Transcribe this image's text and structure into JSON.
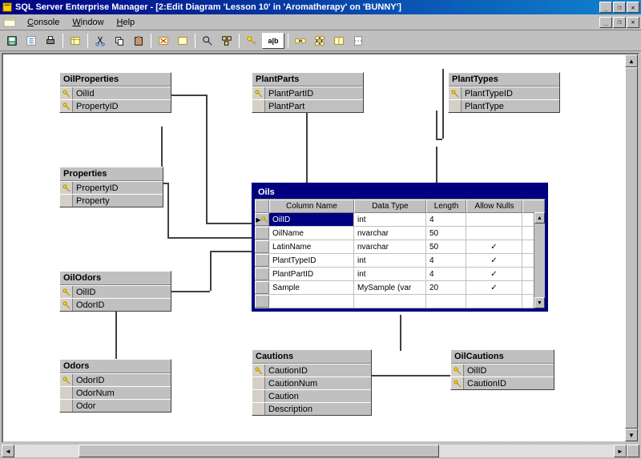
{
  "window": {
    "title": "SQL Server Enterprise Manager - [2:Edit Diagram 'Lesson 10' in 'Aromatherapy' on 'BUNNY']"
  },
  "menu": {
    "console": "Console",
    "window": "Window",
    "help": "Help"
  },
  "toolbar": {
    "ab_label": "a|b"
  },
  "tables": {
    "oilproperties": {
      "title": "OilProperties",
      "cols": [
        {
          "key": true,
          "name": "OilId"
        },
        {
          "key": true,
          "name": "PropertyID"
        }
      ]
    },
    "plantparts": {
      "title": "PlantParts",
      "cols": [
        {
          "key": true,
          "name": "PlantPartID"
        },
        {
          "key": false,
          "name": "PlantPart"
        }
      ]
    },
    "planttypes": {
      "title": "PlantTypes",
      "cols": [
        {
          "key": true,
          "name": "PlantTypeID"
        },
        {
          "key": false,
          "name": "PlantType"
        }
      ]
    },
    "properties": {
      "title": "Properties",
      "cols": [
        {
          "key": true,
          "name": "PropertyID"
        },
        {
          "key": false,
          "name": "Property"
        }
      ]
    },
    "oilodors": {
      "title": "OilOdors",
      "cols": [
        {
          "key": true,
          "name": "OilID"
        },
        {
          "key": true,
          "name": "OdorID"
        }
      ]
    },
    "odors": {
      "title": "Odors",
      "cols": [
        {
          "key": true,
          "name": "OdorID"
        },
        {
          "key": false,
          "name": "OdorNum"
        },
        {
          "key": false,
          "name": "Odor"
        }
      ]
    },
    "cautions": {
      "title": "Cautions",
      "cols": [
        {
          "key": true,
          "name": "CautionID"
        },
        {
          "key": false,
          "name": "CautionNum"
        },
        {
          "key": false,
          "name": "Caution"
        },
        {
          "key": false,
          "name": "Description"
        }
      ]
    },
    "oilcautions": {
      "title": "OilCautions",
      "cols": [
        {
          "key": true,
          "name": "OilID"
        },
        {
          "key": true,
          "name": "CautionID"
        }
      ]
    },
    "oils": {
      "title": "Oils",
      "headers": {
        "colname": "Column Name",
        "datatype": "Data Type",
        "length": "Length",
        "allownulls": "Allow Nulls"
      },
      "rows": [
        {
          "selected": true,
          "key": true,
          "name": "OilID",
          "type": "int",
          "len": "4",
          "nulls": ""
        },
        {
          "selected": false,
          "key": false,
          "name": "OilName",
          "type": "nvarchar",
          "len": "50",
          "nulls": ""
        },
        {
          "selected": false,
          "key": false,
          "name": "LatinName",
          "type": "nvarchar",
          "len": "50",
          "nulls": "✓"
        },
        {
          "selected": false,
          "key": false,
          "name": "PlantTypeID",
          "type": "int",
          "len": "4",
          "nulls": "✓"
        },
        {
          "selected": false,
          "key": false,
          "name": "PlantPartID",
          "type": "int",
          "len": "4",
          "nulls": "✓"
        },
        {
          "selected": false,
          "key": false,
          "name": "Sample",
          "type": "MySample (var",
          "len": "20",
          "nulls": "✓"
        }
      ]
    }
  }
}
